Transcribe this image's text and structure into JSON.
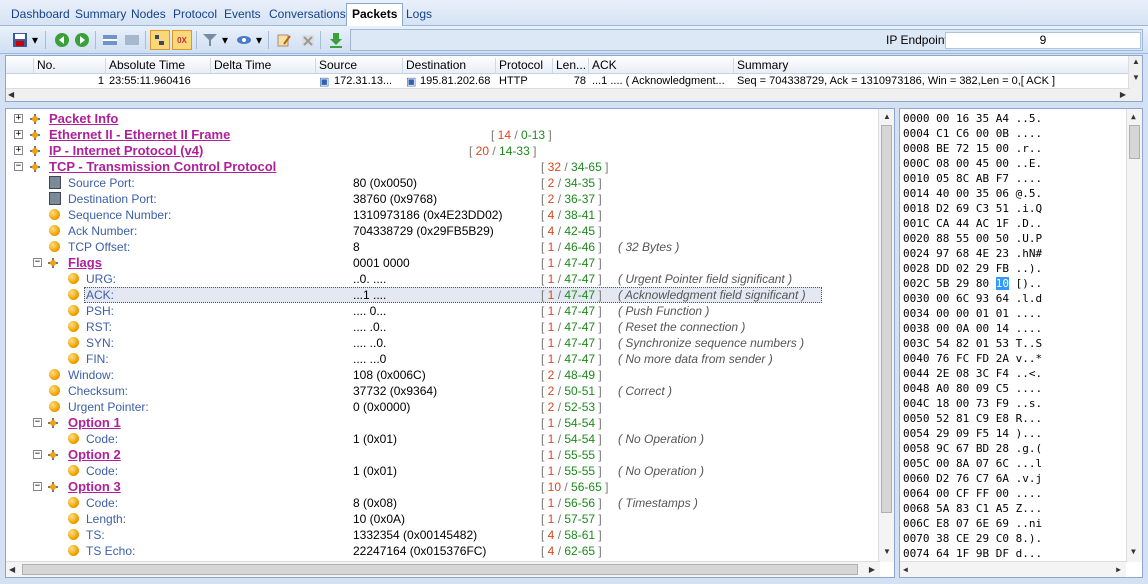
{
  "tabs": [
    "Dashboard",
    "Summary",
    "Nodes",
    "Protocol",
    "Events",
    "Conversations",
    "Packets",
    "Logs"
  ],
  "active_tab": "Packets",
  "toolbar": {
    "ip_endpoint_label": "IP Endpoint",
    "ip_endpoint_value": "9"
  },
  "packet_list": {
    "columns": [
      "No.",
      "Absolute Time",
      "Delta Time",
      "Source",
      "Destination",
      "Protocol",
      "Len...",
      "ACK",
      "Summary"
    ],
    "row": {
      "no": "1",
      "abs_time": "23:55:11.960416",
      "delta": "",
      "source": "172.31.13...",
      "destination": "195.81.202.68",
      "protocol": "HTTP",
      "length": "78",
      "ack": "...1 .... ( Acknowledgment...",
      "summary": "Seq = 704338729, Ack = 1310973186, Win = 382,Len = 0,[ ACK ]"
    }
  },
  "tree": {
    "headers": [
      {
        "label": "Packet Info",
        "len": "",
        "off": ""
      },
      {
        "label": "Ethernet II - Ethernet II Frame",
        "len": "14",
        "off": "0-13"
      },
      {
        "label": "IP - Internet Protocol (v4)",
        "len": "20",
        "off": "14-33"
      },
      {
        "label": "TCP - Transmission Control Protocol",
        "len": "32",
        "off": "34-65"
      }
    ],
    "fields": [
      {
        "label": "Source Port:",
        "value": "80 (0x0050)",
        "len": "2",
        "off": "34-35",
        "note": ""
      },
      {
        "label": "Destination Port:",
        "value": "38760 (0x9768)",
        "len": "2",
        "off": "36-37",
        "note": ""
      },
      {
        "label": "Sequence Number:",
        "value": "1310973186 (0x4E23DD02)",
        "len": "4",
        "off": "38-41",
        "note": ""
      },
      {
        "label": "Ack Number:",
        "value": "704338729 (0x29FB5B29)",
        "len": "4",
        "off": "42-45",
        "note": ""
      },
      {
        "label": "TCP Offset:",
        "value": "8",
        "len": "1",
        "off": "46-46",
        "note": "32 Bytes"
      },
      {
        "label": "Flags",
        "value": "0001 0000",
        "len": "1",
        "off": "47-47",
        "note": ""
      },
      {
        "label": "URG:",
        "value": "..0. ....",
        "len": "1",
        "off": "47-47",
        "note": "Urgent Pointer field significant"
      },
      {
        "label": "ACK:",
        "value": "...1 ....",
        "len": "1",
        "off": "47-47",
        "note": "Acknowledgment field significant"
      },
      {
        "label": "PSH:",
        "value": ".... 0...",
        "len": "1",
        "off": "47-47",
        "note": "Push Function"
      },
      {
        "label": "RST:",
        "value": ".... .0..",
        "len": "1",
        "off": "47-47",
        "note": "Reset the connection"
      },
      {
        "label": "SYN:",
        "value": ".... ..0.",
        "len": "1",
        "off": "47-47",
        "note": "Synchronize sequence numbers"
      },
      {
        "label": "FIN:",
        "value": ".... ...0",
        "len": "1",
        "off": "47-47",
        "note": "No more data from sender"
      },
      {
        "label": "Window:",
        "value": "108 (0x006C)",
        "len": "2",
        "off": "48-49",
        "note": ""
      },
      {
        "label": "Checksum:",
        "value": "37732 (0x9364)",
        "len": "2",
        "off": "50-51",
        "note": "Correct"
      },
      {
        "label": "Urgent Pointer:",
        "value": "0 (0x0000)",
        "len": "2",
        "off": "52-53",
        "note": ""
      },
      {
        "label": "Option 1",
        "value": "",
        "len": "1",
        "off": "54-54",
        "note": ""
      },
      {
        "label": "Code:",
        "value": "1 (0x01)",
        "len": "1",
        "off": "54-54",
        "note": "No Operation"
      },
      {
        "label": "Option 2",
        "value": "",
        "len": "1",
        "off": "55-55",
        "note": ""
      },
      {
        "label": "Code:",
        "value": "1 (0x01)",
        "len": "1",
        "off": "55-55",
        "note": "No Operation"
      },
      {
        "label": "Option 3",
        "value": "",
        "len": "10",
        "off": "56-65",
        "note": ""
      },
      {
        "label": "Code:",
        "value": "8 (0x08)",
        "len": "1",
        "off": "56-56",
        "note": "Timestamps"
      },
      {
        "label": "Length:",
        "value": "10 (0x0A)",
        "len": "1",
        "off": "57-57",
        "note": ""
      },
      {
        "label": "TS:",
        "value": "1332354 (0x00145482)",
        "len": "4",
        "off": "58-61",
        "note": ""
      },
      {
        "label": "TS Echo:",
        "value": "22247164 (0x015376FC)",
        "len": "4",
        "off": "62-65",
        "note": ""
      }
    ]
  },
  "hex": [
    "0000 00 16 35 A4 ..5.",
    "0004 C1 C6 00 0B ....",
    "0008 BE 72 15 00 .r..",
    "000C 08 00 45 00 ..E.",
    "0010 05 8C AB F7 ....",
    "0014 40 00 35 06 @.5.",
    "0018 D2 69 C3 51 .i.Q",
    "001C CA 44 AC 1F .D..",
    "0020 88 55 00 50 .U.P",
    "0024 97 68 4E 23 .hN#",
    "0028 DD 02 29 FB ..).",
    "002C 5B 29 80 10 [)..",
    "0030 00 6C 93 64 .l.d",
    "0034 00 00 01 01 ....",
    "0038 00 0A 00 14 ....",
    "003C 54 82 01 53 T..S",
    "0040 76 FC FD 2A v..*",
    "0044 2E 08 3C F4 ..<.",
    "0048 A0 80 09 C5 ....",
    "004C 18 00 73 F9 ..s.",
    "0050 52 81 C9 E8 R...",
    "0054 29 09 F5 14 )...",
    "0058 9C 67 BD 28 .g.(",
    "005C 00 8A 07 6C ...l",
    "0060 D2 76 C7 6A .v.j",
    "0064 00 CF FF 00 ....",
    "0068 5A 83 C1 A5 Z...",
    "006C E8 07 6E 69 ..ni",
    "0070 38 CE 29 C0 8.).",
    "0074 64 1F 9B DF d..."
  ]
}
